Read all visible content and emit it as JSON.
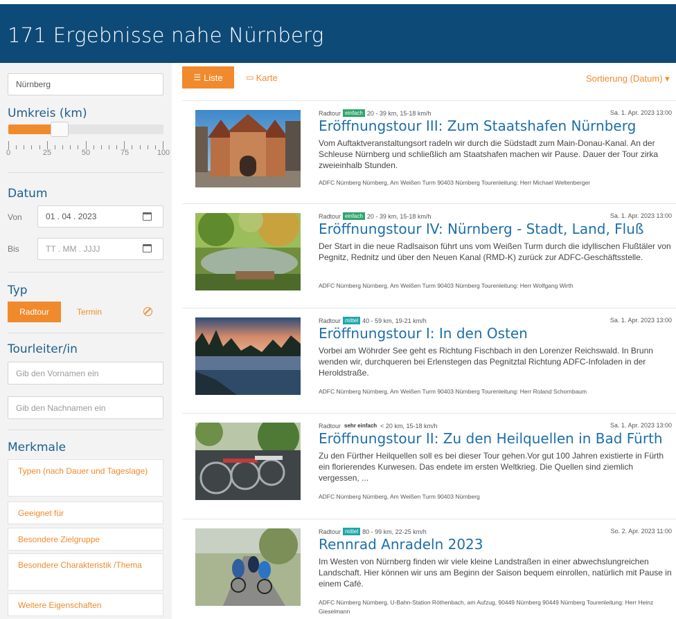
{
  "header": {
    "title": "171 Ergebnisse nahe Nürnberg"
  },
  "sidebar": {
    "location_value": "Nürnberg",
    "umkreis_title": "Umkreis (km)",
    "umkreis_value": 0.33,
    "tick_labels": [
      "0",
      "25",
      "50",
      "75",
      "100"
    ],
    "datum_title": "Datum",
    "von_label": "Von",
    "von_value": "01 . 04 . 2023",
    "bis_label": "Bis",
    "bis_placeholder": "TT . MM . JJJJ",
    "typ_title": "Typ",
    "typ_radtour": "Radtour",
    "typ_termin": "Termin",
    "tourleiter_title": "Tourleiter/in",
    "vorname_placeholder": "Gib den Vornamen ein",
    "nachname_placeholder": "Gib den Nachnamen ein",
    "merkmale_title": "Merkmale",
    "merkmale": [
      "Typen (nach Dauer und Tageslage)",
      "Geeignet für",
      "Besondere Zielgruppe",
      "Besondere Charakteristik /Thema",
      "Weitere Eigenschaften"
    ]
  },
  "toolbar": {
    "list_label": "Liste",
    "map_label": "Karte",
    "sort_label": "Sortierung (Datum) ▾"
  },
  "results": [
    {
      "type": "Radtour",
      "level": "einfach",
      "details": "20 - 39 km, 15-18 km/h",
      "date": "Sa. 1. Apr. 2023 13:00",
      "title": "Eröffnungstour III: Zum Staatshafen Nürnberg",
      "description": "Vom Auftaktveranstaltungsort radeln wir durch die Südstadt zum Main-Donau-Kanal. An der Schleuse Nürnberg und schließlich am Staatshafen machen wir Pause. Dauer der Tour zirka zweieinhalb Stunden.",
      "footer": "ADFC Nürnberg Nürnberg, Am Weißen Turm 90403 Nürnberg Tourenleitung: Herr Michael Weltenberger"
    },
    {
      "type": "Radtour",
      "level": "einfach",
      "details": "20 - 39 km, 15-18 km/h",
      "date": "Sa. 1. Apr. 2023 13:00",
      "title": "Eröffnungstour IV: Nürnberg - Stadt, Land, Fluß",
      "description": "Der Start in die neue Radlsaison führt uns vom Weißen Turm durch die idyllischen Flußtäler von Pegnitz, Rednitz und über den Neuen Kanal (RMD-K) zurück zur ADFC-Geschäftsstelle.",
      "footer": "ADFC Nürnberg Nürnberg, Am Weißen Turm 90403 Nürnberg Tourenleitung: Herr Wolfgang Wirth"
    },
    {
      "type": "Radtour",
      "level": "mittel",
      "details": "40 - 59 km, 19-21 km/h",
      "date": "Sa. 1. Apr. 2023 13:00",
      "title": "Eröffnungstour I: In den Osten",
      "description": "Vorbei am Wöhrder See geht es Richtung Fischbach in den Lorenzer Reichswald. In Brunn wenden wir, durchqueren bei Erlenstegen das Pegnitztal Richtung ADFC-Infoladen in der Heroldstraße.",
      "footer": "ADFC Nürnberg Nürnberg, Am Weißen Turm 90403 Nürnberg Tourenleitung: Herr Roland Schornbaum"
    },
    {
      "type": "Radtour",
      "level": "sehr einfach",
      "details": "< 20 km, 15-18 km/h",
      "date": "Sa. 1. Apr. 2023 13:00",
      "title": "Eröffnungstour II: Zu den Heilquellen in Bad Fürth",
      "description": "Zu den Fürther Heilquellen soll es bei dieser Tour gehen.Vor gut 100 Jahren existierte in Fürth ein florierendes Kurwesen. Das endete im ersten Weltkrieg. Die Quellen sind ziemlich vergessen, ...",
      "footer": "ADFC Nürnberg Nürnberg, Am Weißen Turm 90403 Nürnberg"
    },
    {
      "type": "Radtour",
      "level": "mittel",
      "details": "80 - 99 km, 22-25 km/h",
      "date": "So. 2. Apr. 2023 11:00",
      "title": "Rennrad Anradeln 2023",
      "description": "Im Westen von Nürnberg finden wir viele kleine Landstraßen in einer abwechslungreichen Landschaft. Hier können wir uns am Beginn der Saison bequem einrollen, natürlich mit Pause in einem Café.",
      "footer": "ADFC Nürnberg Nürnberg, U-Bahn-Station Röthenbach, am Aufzug, 90449 Nürnberg 90449 Nürnberg Tourenleitung: Herr Heinz Gieselmann"
    }
  ]
}
